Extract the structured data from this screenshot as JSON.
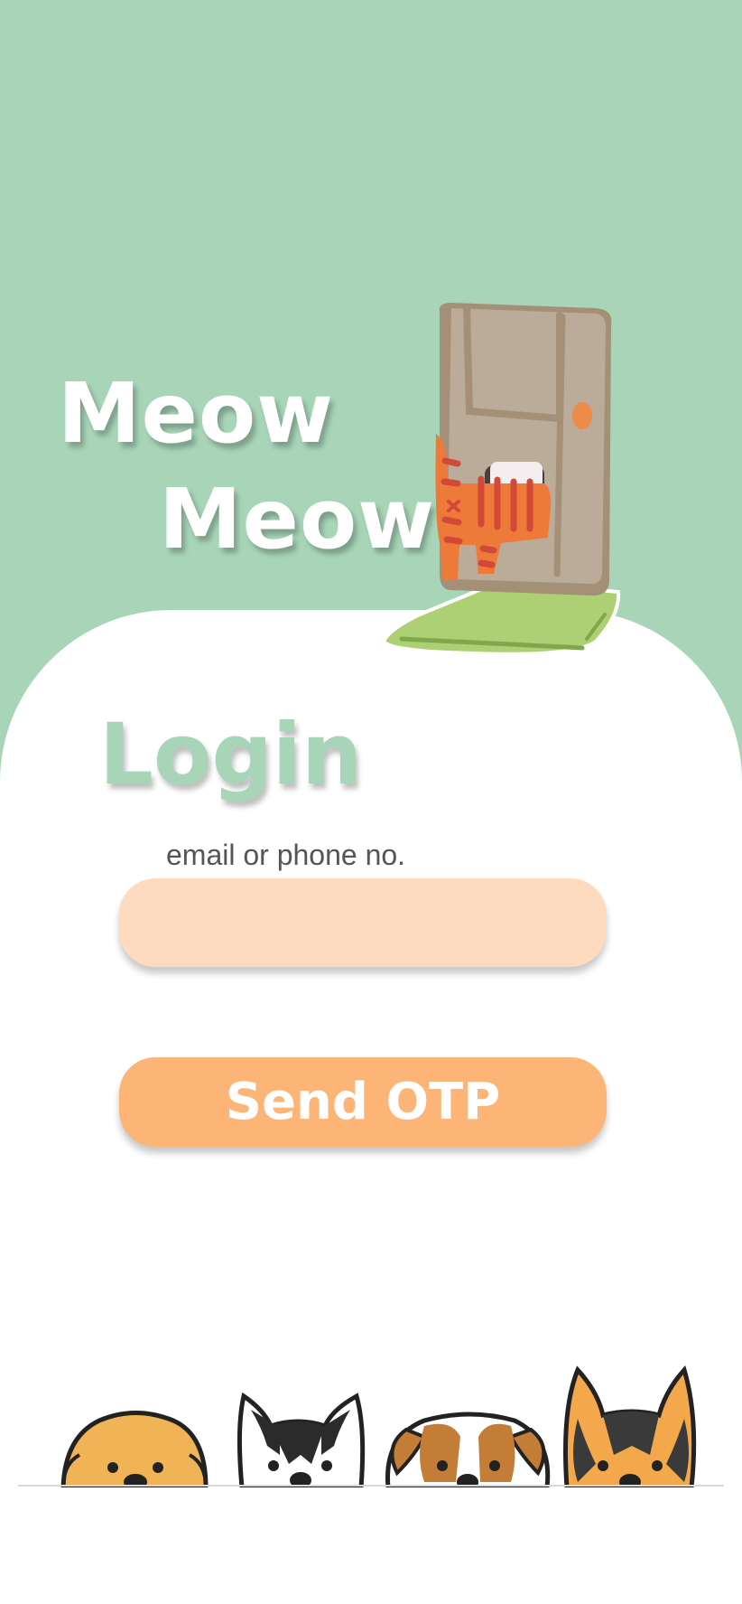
{
  "hero": {
    "line1": "Meow",
    "line2": "Meow!"
  },
  "login": {
    "heading": "Login",
    "field_label": "email or phone no.",
    "field_value": "",
    "button_label": "Send OTP"
  },
  "colors": {
    "background": "#a8d5b8",
    "card": "#ffffff",
    "input": "#fedbbe",
    "button": "#fdb577",
    "heading": "#a8d5b8"
  }
}
